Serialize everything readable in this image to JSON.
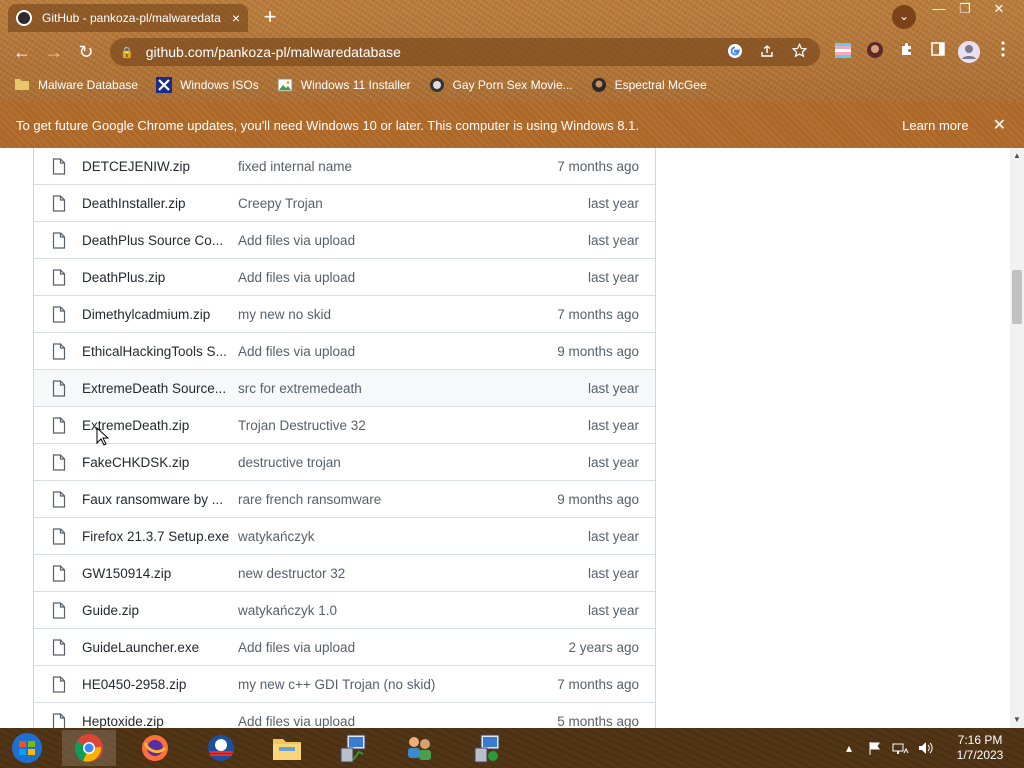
{
  "browser": {
    "tab": {
      "title": "GitHub - pankoza-pl/malwaredata",
      "close": "×"
    },
    "new_tab": "+",
    "tab_search": "⌄",
    "window_controls": {
      "minimize": "—",
      "restore": "❐",
      "close": "✕"
    },
    "nav": {
      "back": "←",
      "forward": "→",
      "reload": "↻"
    },
    "address": {
      "lock": "🔒",
      "url": "github.com/pankoza-pl/malwaredatabase"
    },
    "bookmarks": [
      {
        "label": "Malware Database",
        "icon": "folder-icon"
      },
      {
        "label": "Windows ISOs",
        "icon": "x-logo-icon"
      },
      {
        "label": "Windows 11 Installer",
        "icon": "image-icon"
      },
      {
        "label": "Gay Porn Sex Movie...",
        "icon": "site-icon"
      },
      {
        "label": "Espectral McGee",
        "icon": "avatar-icon"
      }
    ]
  },
  "infobar": {
    "message": "To get future Google Chrome updates, you'll need Windows 10 or later. This computer is using Windows 8.1.",
    "learn_more": "Learn more",
    "close": "✕"
  },
  "files": [
    {
      "name": "DETCEJENIW.zip",
      "commit": "fixed internal name",
      "age": "7 months ago"
    },
    {
      "name": "DeathInstaller.zip",
      "commit": "Creepy Trojan",
      "age": "last year"
    },
    {
      "name": "DeathPlus Source Co...",
      "commit": "Add files via upload",
      "age": "last year"
    },
    {
      "name": "DeathPlus.zip",
      "commit": "Add files via upload",
      "age": "last year"
    },
    {
      "name": "Dimethylcadmium.zip",
      "commit": "my new no skid",
      "age": "7 months ago"
    },
    {
      "name": "EthicalHackingTools S...",
      "commit": "Add files via upload",
      "age": "9 months ago"
    },
    {
      "name": "ExtremeDeath Source...",
      "commit": "src for extremedeath",
      "age": "last year"
    },
    {
      "name": "ExtremeDeath.zip",
      "commit": "Trojan Destructive 32",
      "age": "last year"
    },
    {
      "name": "FakeCHKDSK.zip",
      "commit": "destructive trojan",
      "age": "last year"
    },
    {
      "name": "Faux ransomware by ...",
      "commit": "rare french ransomware",
      "age": "9 months ago"
    },
    {
      "name": "Firefox 21.3.7 Setup.exe",
      "commit": "watykańczyk",
      "age": "last year"
    },
    {
      "name": "GW150914.zip",
      "commit": "new destructor 32",
      "age": "last year"
    },
    {
      "name": "Guide.zip",
      "commit": "watykańczyk 1.0",
      "age": "last year"
    },
    {
      "name": "GuideLauncher.exe",
      "commit": "Add files via upload",
      "age": "2 years ago"
    },
    {
      "name": "HE0450-2958.zip",
      "commit": "my new c++ GDI Trojan (no skid)",
      "age": "7 months ago"
    },
    {
      "name": "Heptoxide.zip",
      "commit": "Add files via upload",
      "age": "5 months ago"
    }
  ],
  "hovered_row": 6,
  "taskbar": {
    "apps": [
      "start-orb-icon",
      "chrome-icon",
      "firefox-icon",
      "obama-logo-icon",
      "file-explorer-icon",
      "computer-setup-icon",
      "network-people-icon",
      "computer-setup-icon"
    ],
    "active_index": 1,
    "clock": {
      "time": "7:16 PM",
      "date": "1/7/2023"
    }
  },
  "colors": {
    "chrome_frame": "#b8793a",
    "infobar": "#b06a2a",
    "taskbar": "#4b3114",
    "link_text": "#24292f",
    "muted_text": "#57606a"
  }
}
